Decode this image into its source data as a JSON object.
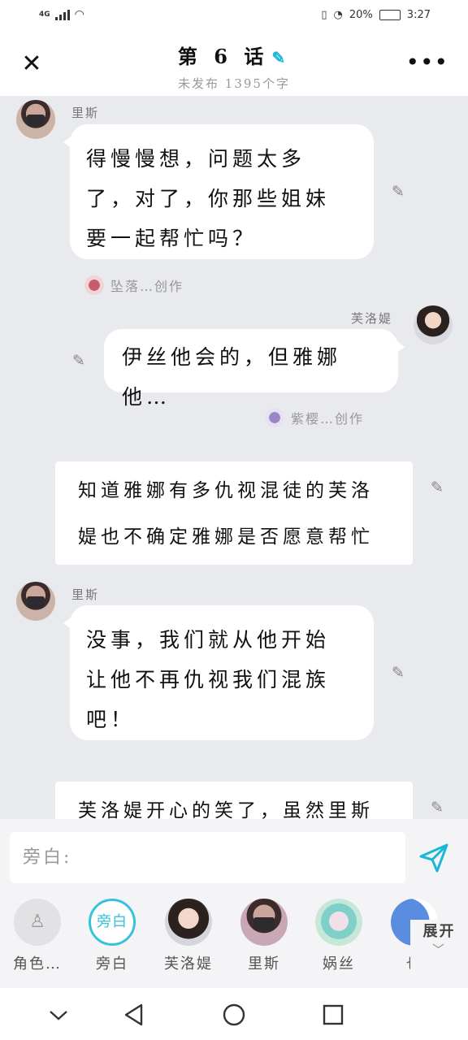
{
  "status": {
    "network": "4G",
    "battery": "20%",
    "time": "3:27"
  },
  "header": {
    "title": "第 6 话",
    "subtitle": "未发布 1395个字"
  },
  "messages": [
    {
      "speaker": "里斯",
      "text_lines": [
        "得慢慢想，问题太多",
        "了，对了，你那些姐妹",
        "要一起帮忙吗？"
      ],
      "credit": "坠落…创作"
    },
    {
      "speaker": "芙洛媞",
      "text": "伊丝他会的，但雅娜他…",
      "credit": "紫樱…创作"
    },
    {
      "narration_lines": [
        "知道雅娜有多仇视混徒的芙洛",
        "媞也不确定雅娜是否愿意帮忙"
      ]
    },
    {
      "speaker": "里斯",
      "text_lines": [
        "没事，我们就从他开始",
        "让他不再仇视我们混族",
        "吧！"
      ]
    },
    {
      "narration_lines": [
        "芙洛媞开心的笑了，虽然里斯"
      ]
    }
  ],
  "input": {
    "placeholder": "旁白:"
  },
  "roles": [
    {
      "label": "角色…"
    },
    {
      "label": "旁白",
      "circle_text": "旁白"
    },
    {
      "label": "芙洛媞"
    },
    {
      "label": "里斯"
    },
    {
      "label": "娲丝"
    },
    {
      "label": "也"
    }
  ],
  "expand_label": "展开",
  "icons": {
    "accent": "#1ab7d6",
    "send": "send-icon",
    "edit": "edit-pencil-icon"
  }
}
